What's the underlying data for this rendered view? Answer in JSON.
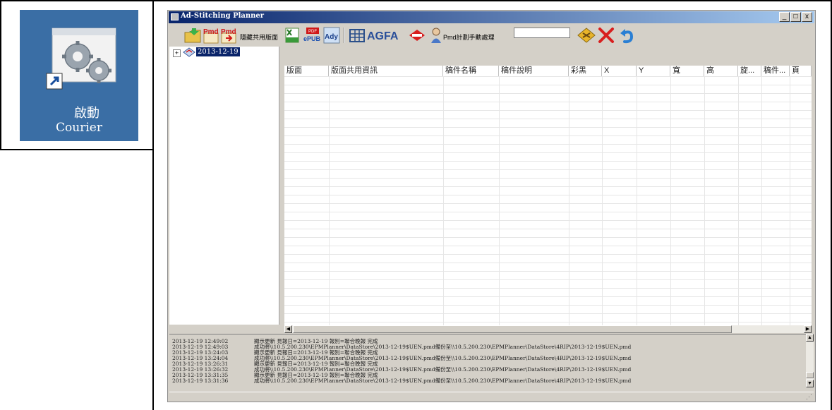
{
  "shortcut": {
    "label_line1": "啟動",
    "label_line2": "Courier",
    "icon": "gear-shortcut-icon"
  },
  "window": {
    "title": "Ad-Stitching Planner",
    "controls": [
      "_",
      "□",
      "x"
    ]
  },
  "toolbar": {
    "hide_shared_pages": "隱藏共用版面",
    "pmd_manual_processing": "Pmd計劃手動處理",
    "plan_input_value": "",
    "icons": [
      "open-folder-icon",
      "pmd-icon",
      "pmd-export-icon",
      "excel-icon",
      "pdf-epub-icon",
      "ady-icon",
      "grid-icon",
      "agfa-logo",
      "agfa-diamond-icon",
      "user-icon",
      "diamond-arrows-icon",
      "delete-x-icon",
      "undo-icon"
    ],
    "labels": {
      "pmd1": "Pmd",
      "pmd2": "Pmd",
      "pdf": "PDF",
      "epub": "ePUB",
      "ady": "Ady",
      "agfa": "AGFA"
    }
  },
  "tree": {
    "expander": "+",
    "root_label": "2013-12-19"
  },
  "grid": {
    "columns": [
      "版面",
      "版面共用資訊",
      "稿件名稱",
      "稿件說明",
      "彩黑",
      "X",
      "Y",
      "寬",
      "高",
      "旋...",
      "稿件...",
      "頁"
    ]
  },
  "log": [
    {
      "time": "2013-12-19 12:49:02",
      "message": "顯示更新 見報日=2013-12-19 報別=聯合晚報 完成"
    },
    {
      "time": "2013-12-19 12:49:03",
      "message": "成功將\\\\10.5.200.230\\EPMPlanner\\DataStore\\2013-12-19$UEN.pmd備份至\\\\10.5.200.230\\EPMPlanner\\DataStore\\4RIP\\2013-12-19$UEN.pmd"
    },
    {
      "time": "2013-12-19 13:24:03",
      "message": "顯示更新 見報日=2013-12-19 報別=聯合晚報 完成"
    },
    {
      "time": "2013-12-19 13:24:04",
      "message": "成功將\\\\10.5.200.230\\EPMPlanner\\DataStore\\2013-12-19$UEN.pmd備份至\\\\10.5.200.230\\EPMPlanner\\DataStore\\4RIP\\2013-12-19$UEN.pmd"
    },
    {
      "time": "2013-12-19 13:26:31",
      "message": "顯示更新 見報日=2013-12-19 報別=聯合晚報 完成"
    },
    {
      "time": "2013-12-19 13:26:32",
      "message": "成功將\\\\10.5.200.230\\EPMPlanner\\DataStore\\2013-12-19$UEN.pmd備份至\\\\10.5.200.230\\EPMPlanner\\DataStore\\4RIP\\2013-12-19$UEN.pmd"
    },
    {
      "time": "2013-12-19 13:31:35",
      "message": "顯示更新 見報日=2013-12-19 報別=聯合晚報 完成"
    },
    {
      "time": "2013-12-19 13:31:36",
      "message": "成功將\\\\10.5.200.230\\EPMPlanner\\DataStore\\2013-12-19$UEN.pmd備份至\\\\10.5.200.230\\EPMPlanner\\DataStore\\4RIP\\2013-12-19$UEN.pmd"
    }
  ],
  "colors": {
    "desktop_tile": "#3a6ea5",
    "title_gradient_start": "#08246b",
    "title_gradient_end": "#a6caf0",
    "window_face": "#d4d0c8",
    "delete_red": "#d81e1e",
    "undo_blue": "#2a7fd4"
  }
}
